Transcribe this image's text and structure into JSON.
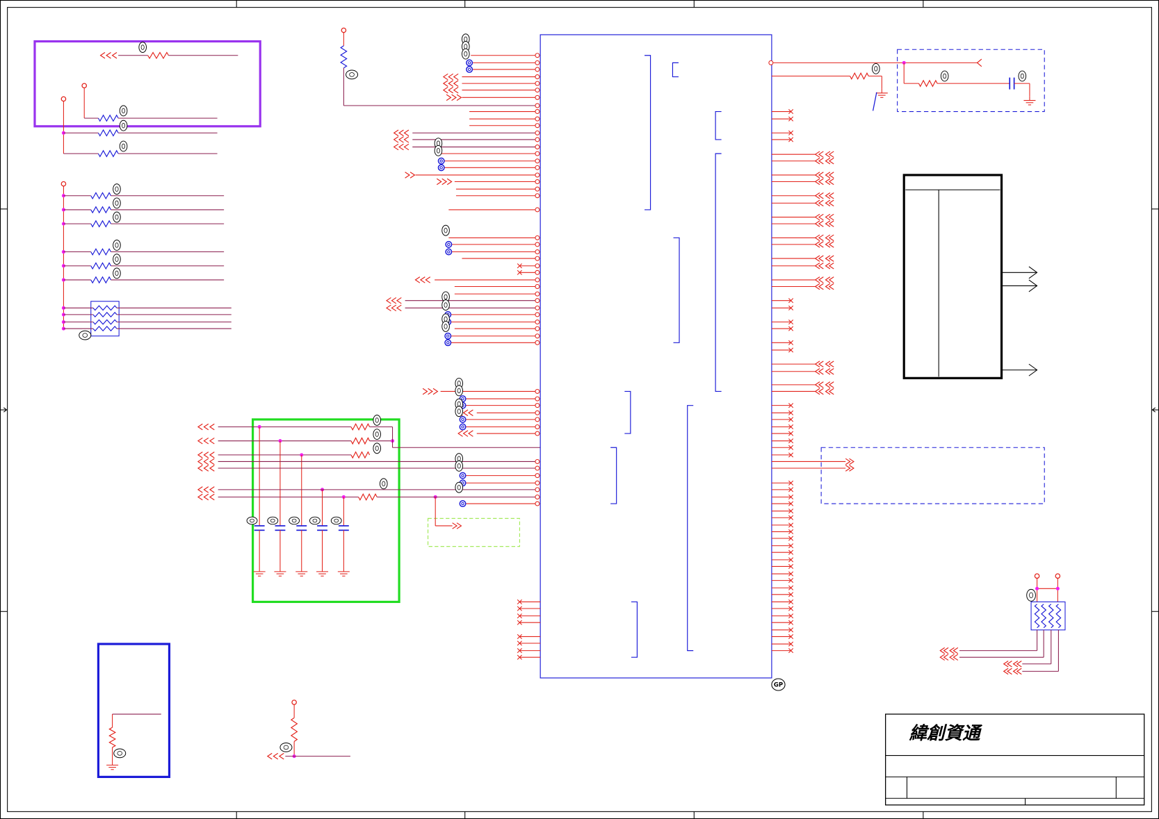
{
  "title_block": {
    "company": "緯創資通"
  },
  "ic": {
    "tag_label": "GP"
  },
  "colors": {
    "wire": "#8b1f4f",
    "red": "#e3231b",
    "blue": "#1c1cd8",
    "junction": "#f21ef2",
    "purple_box": "#9933ee",
    "green_box": "#22dd22",
    "green_dashed": "#9be84a"
  }
}
